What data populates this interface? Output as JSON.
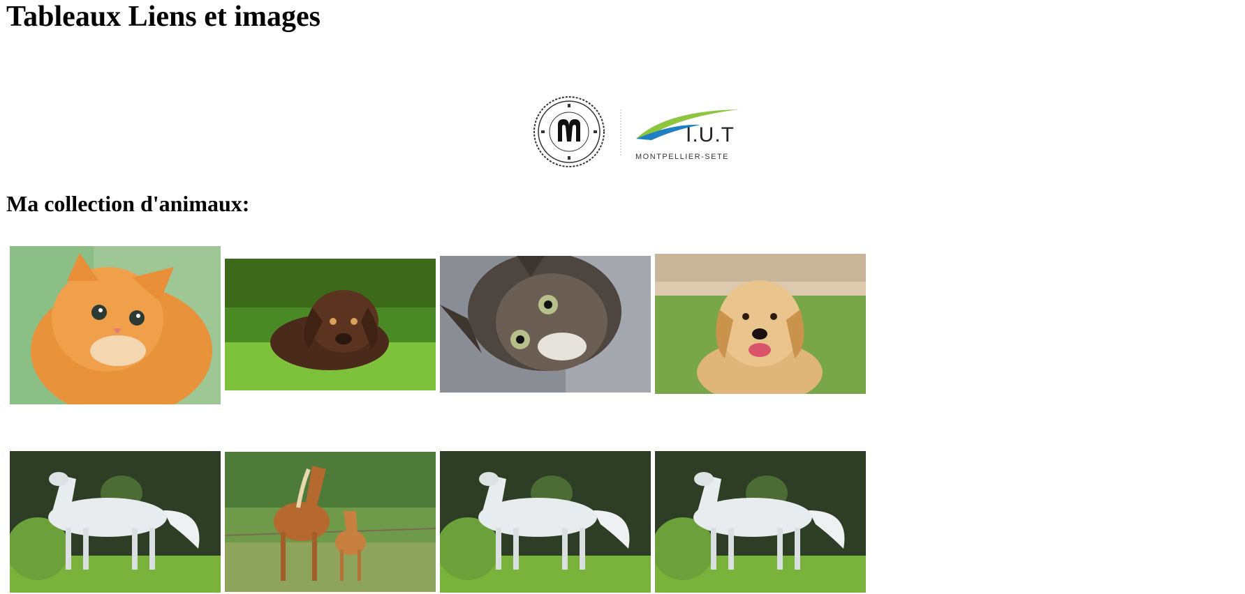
{
  "page": {
    "title": "Tableaux Liens et images",
    "section_heading": "Ma collection d'animaux:"
  },
  "logos": {
    "university": {
      "icon": "universite-montpellier-seal"
    },
    "iut": {
      "brand_text": "I.U.T",
      "subtitle": "MONTPELLIER-SETE"
    }
  },
  "gallery": {
    "row1": [
      {
        "subject": "orange-kitten"
      },
      {
        "subject": "brown-labrador-puppy"
      },
      {
        "subject": "tabby-kitten-looking-up"
      },
      {
        "subject": "golden-retriever"
      }
    ],
    "row2": [
      {
        "subject": "white-horse"
      },
      {
        "subject": "horse-and-foal"
      },
      {
        "subject": "white-horse"
      },
      {
        "subject": "white-horse"
      }
    ]
  },
  "colors": {
    "text": "#000000",
    "background": "#ffffff",
    "iut_green": "#8cc63f",
    "iut_blue": "#1e7fc3"
  }
}
